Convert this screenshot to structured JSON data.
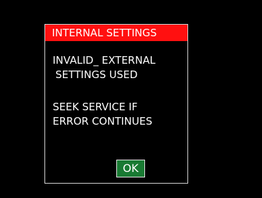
{
  "dialog": {
    "title": "INTERNAL SETTINGS",
    "message_lines": [
      "INVALID_ EXTERNAL",
      "SETTINGS USED",
      "SEEK SERVICE IF",
      "ERROR CONTINUES"
    ],
    "ok_label": "OK"
  },
  "colors": {
    "background": "#000000",
    "title_bar": "#ff1010",
    "ok_button": "#197a33",
    "text": "#ffffff",
    "border": "#d8d8d8"
  }
}
